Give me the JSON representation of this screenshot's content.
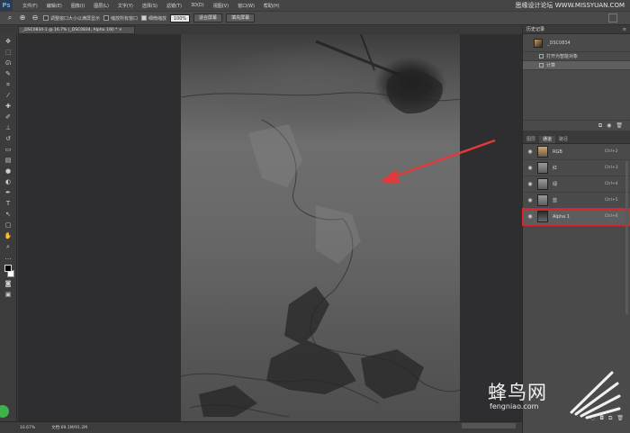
{
  "menubar": {
    "logo": "Ps",
    "items": [
      "文件(F)",
      "编辑(E)",
      "图像(I)",
      "图层(L)",
      "文字(Y)",
      "选择(S)",
      "滤镜(T)",
      "3D(D)",
      "视图(V)",
      "窗口(W)",
      "帮助(H)"
    ],
    "watermark": "思缘设计论坛 WWW.MISSYUAN.COM"
  },
  "optionsbar": {
    "zoom_glyph": "🔍",
    "resize_windows_label": "调整窗口大小以满屏显示",
    "zoom_all_label": "缩放所有窗口",
    "scrubby_zoom_label": "细微缩放",
    "zoom_value": "100%",
    "fit_screen_label": "适合屏幕",
    "fill_screen_label": "填充屏幕"
  },
  "document": {
    "tab_title": "_DSC0834-1 @ 16.7% (_DSC0834, Alpha 1/8) * ×"
  },
  "statusbar": {
    "zoom": "16.67%",
    "doc_info": "文档:69.1M/91.2M"
  },
  "history": {
    "title": "历史记录",
    "snapshot_name": "_DSC0834",
    "items": [
      {
        "label": "打开为智能对象",
        "active": false
      },
      {
        "label": "计算",
        "active": true
      }
    ]
  },
  "channels": {
    "tabs": [
      {
        "label": "图层",
        "active": false
      },
      {
        "label": "通道",
        "active": true
      },
      {
        "label": "路径",
        "active": false
      }
    ],
    "rows": [
      {
        "name": "RGB",
        "shortcut": "Ctrl+2",
        "thumb": "rgb",
        "visible": true,
        "selected": false
      },
      {
        "name": "红",
        "shortcut": "Ctrl+3",
        "thumb": "gray",
        "visible": true,
        "selected": false
      },
      {
        "name": "绿",
        "shortcut": "Ctrl+4",
        "thumb": "gray",
        "visible": true,
        "selected": false
      },
      {
        "name": "蓝",
        "shortcut": "Ctrl+5",
        "thumb": "gray",
        "visible": true,
        "selected": false
      },
      {
        "name": "Alpha 1",
        "shortcut": "Ctrl+6",
        "thumb": "alpha",
        "visible": true,
        "selected": true
      }
    ]
  },
  "brand": {
    "name_cn": "蜂鸟网",
    "url": "fengniao.com"
  },
  "colors": {
    "highlight": "#d8262c",
    "arrow": "#e23a3a",
    "brand_green": "#3db14a"
  }
}
